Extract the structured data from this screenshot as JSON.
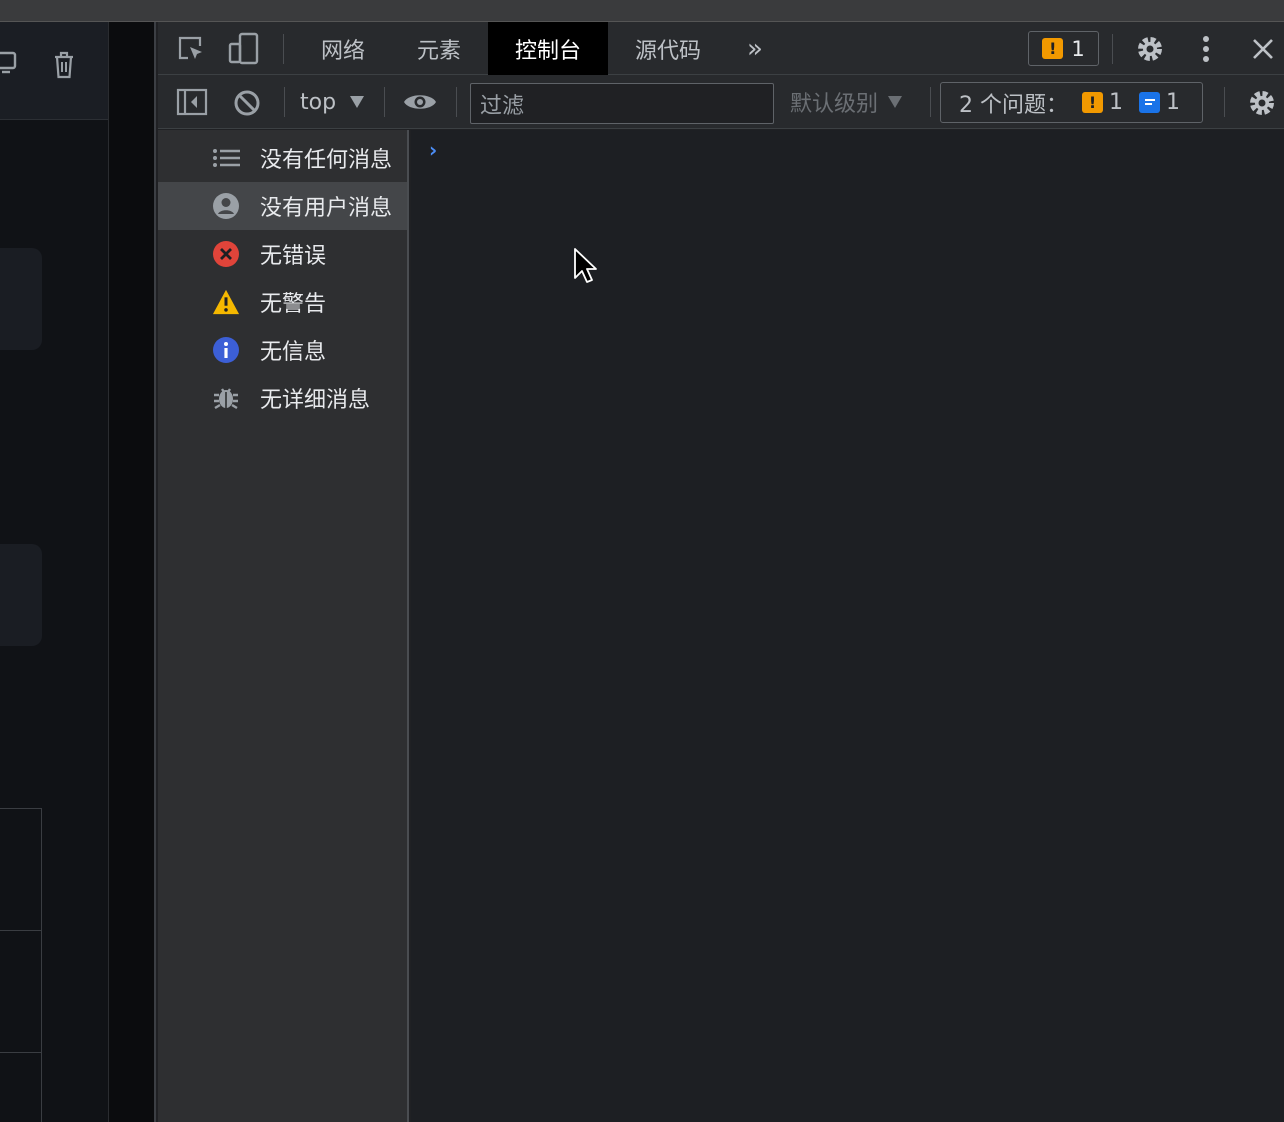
{
  "tabs": {
    "network": "网络",
    "elements": "元素",
    "console": "控制台",
    "sources": "源代码"
  },
  "issues_button": {
    "count": "1"
  },
  "toolbar": {
    "context": "top",
    "filter_placeholder": "过滤",
    "level": "默认级别",
    "issues_label": "2 个问题：",
    "warn_count": "1",
    "info_count": "1"
  },
  "sidebar": {
    "items": [
      {
        "label": "没有任何消息",
        "icon": "list-icon"
      },
      {
        "label": "没有用户消息",
        "icon": "user-icon"
      },
      {
        "label": "无错误",
        "icon": "error-icon"
      },
      {
        "label": "无警告",
        "icon": "warning-icon"
      },
      {
        "label": "无信息",
        "icon": "info-icon"
      },
      {
        "label": "无详细消息",
        "icon": "bug-icon"
      }
    ]
  },
  "console": {
    "prompt": "›"
  },
  "colors": {
    "accent": "#4c8df6",
    "warning": "#f29900",
    "error": "#e0443a",
    "info": "#3c5fd6",
    "issue_info": "#1a73e8"
  }
}
